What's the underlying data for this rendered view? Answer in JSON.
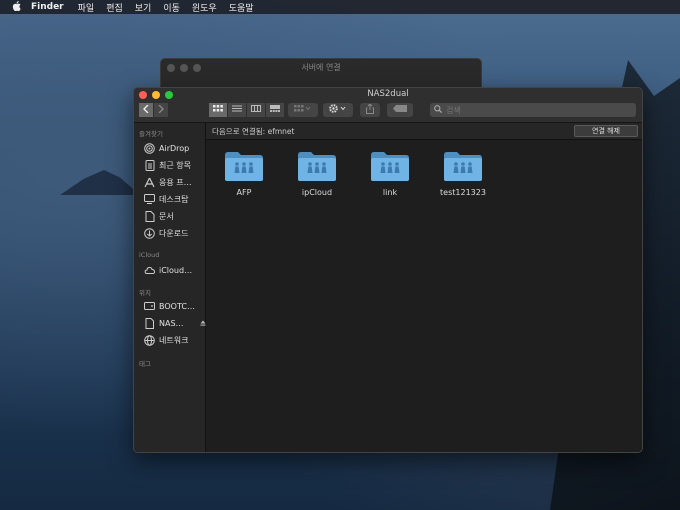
{
  "menubar": {
    "app": "Finder",
    "items": [
      "파일",
      "편집",
      "보기",
      "이동",
      "윈도우",
      "도움말"
    ]
  },
  "back_window": {
    "title": "서버에 연결"
  },
  "window": {
    "title": "NAS2dual",
    "search_placeholder": "검색"
  },
  "sidebar": {
    "favorites_label": "즐겨찾기",
    "favorites": [
      {
        "label": "AirDrop",
        "icon": "airdrop-icon"
      },
      {
        "label": "최근 항목",
        "icon": "recents-icon"
      },
      {
        "label": "응용 프…",
        "icon": "applications-icon"
      },
      {
        "label": "데스크탑",
        "icon": "desktop-icon"
      },
      {
        "label": "문서",
        "icon": "documents-icon"
      },
      {
        "label": "다운로드",
        "icon": "downloads-icon"
      }
    ],
    "icloud_label": "iCloud",
    "icloud": [
      {
        "label": "iCloud…",
        "icon": "cloud-icon"
      }
    ],
    "locations_label": "위치",
    "locations": [
      {
        "label": "BOOTC…",
        "icon": "disk-icon"
      },
      {
        "label": "NAS…",
        "icon": "server-icon"
      },
      {
        "label": "네트워크",
        "icon": "network-icon"
      }
    ],
    "tags_label": "태그"
  },
  "pathbar": {
    "connected_as": "다음으로 연결됨: efmnet",
    "disconnect_label": "연결 해제"
  },
  "folders": [
    {
      "name": "AFP"
    },
    {
      "name": "ipCloud"
    },
    {
      "name": "link"
    },
    {
      "name": "test121323"
    }
  ],
  "colors": {
    "folder": "#6fb4e4",
    "folder_dark": "#4f8fc0",
    "close": "#ff5f57",
    "minimize": "#febc2e",
    "zoom": "#28c840"
  }
}
